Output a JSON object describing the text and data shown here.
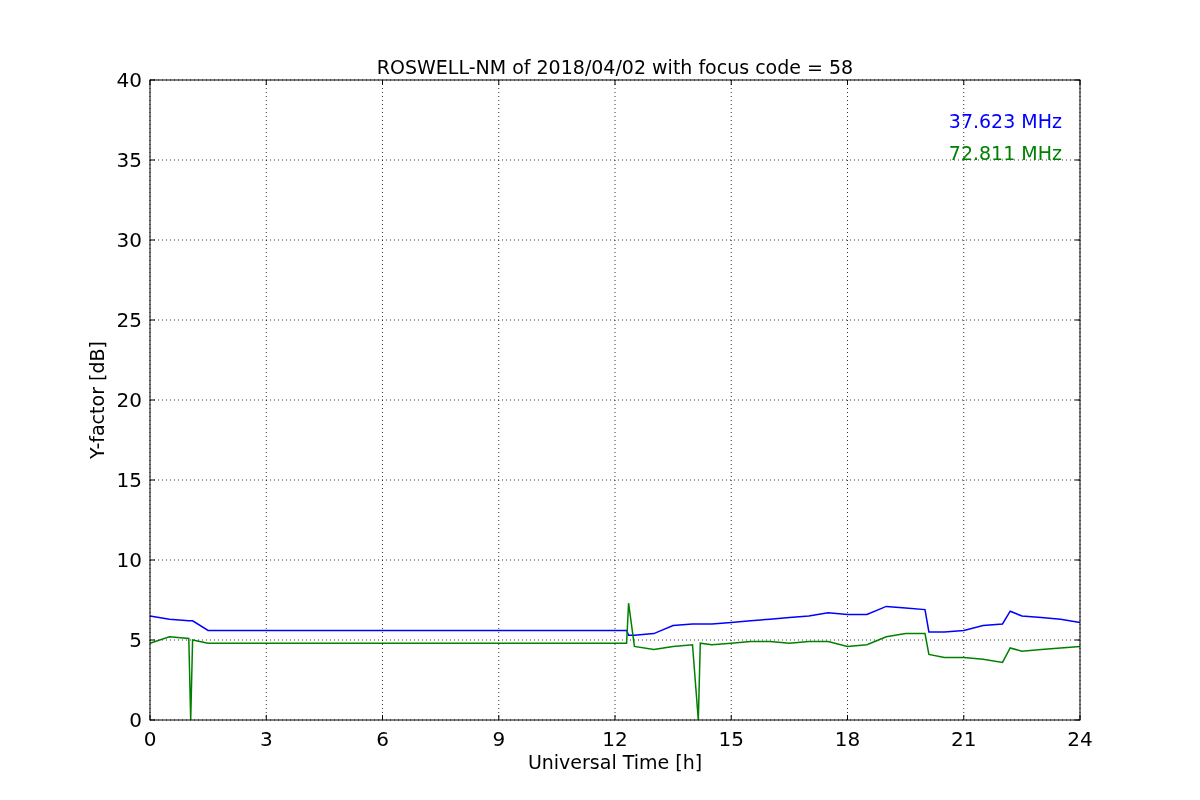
{
  "chart": {
    "chart_data": {
      "type": "line",
      "title": "ROSWELL-NM of 2018/04/02 with focus code = 58",
      "xlabel": "Universal Time [h]",
      "ylabel": "Y-factor [dB]",
      "x": [
        0,
        0.5,
        1,
        1.05,
        1.1,
        1.5,
        12.3,
        12.35,
        12.5,
        13,
        13.5,
        14,
        14.15,
        14.2,
        14.5,
        15,
        15.5,
        16,
        16.5,
        17,
        17.5,
        18,
        18.5,
        19,
        19.5,
        20,
        20.1,
        20.5,
        21,
        21.5,
        22,
        22.2,
        22.5,
        23,
        23.5,
        24
      ],
      "series": [
        {
          "name": "37.623 MHz",
          "color": "#0000ff",
          "values": [
            6.5,
            6.3,
            6.2,
            6.2,
            6.2,
            5.6,
            5.6,
            5.3,
            5.3,
            5.4,
            5.9,
            6.0,
            6.0,
            6.0,
            6.0,
            6.1,
            6.2,
            6.3,
            6.4,
            6.5,
            6.7,
            6.6,
            6.6,
            7.1,
            7.0,
            6.9,
            5.5,
            5.5,
            5.6,
            5.9,
            6.0,
            6.8,
            6.5,
            6.4,
            6.3,
            6.1
          ]
        },
        {
          "name": "72.811 MHz",
          "color": "#008000",
          "values": [
            4.8,
            5.2,
            5.1,
            0,
            5.0,
            4.8,
            4.8,
            7.3,
            4.6,
            4.4,
            4.6,
            4.7,
            0,
            4.8,
            4.7,
            4.8,
            4.9,
            4.9,
            4.8,
            4.9,
            4.9,
            4.6,
            4.7,
            5.2,
            5.4,
            5.4,
            4.1,
            3.9,
            3.9,
            3.8,
            3.6,
            4.5,
            4.3,
            4.4,
            4.5,
            4.6
          ]
        }
      ],
      "xlim": [
        0,
        24
      ],
      "ylim": [
        0,
        40
      ],
      "xticks": [
        0,
        3,
        6,
        9,
        12,
        15,
        18,
        21,
        24
      ],
      "yticks": [
        0,
        5,
        10,
        15,
        20,
        25,
        30,
        35,
        40
      ],
      "grid": true
    }
  }
}
